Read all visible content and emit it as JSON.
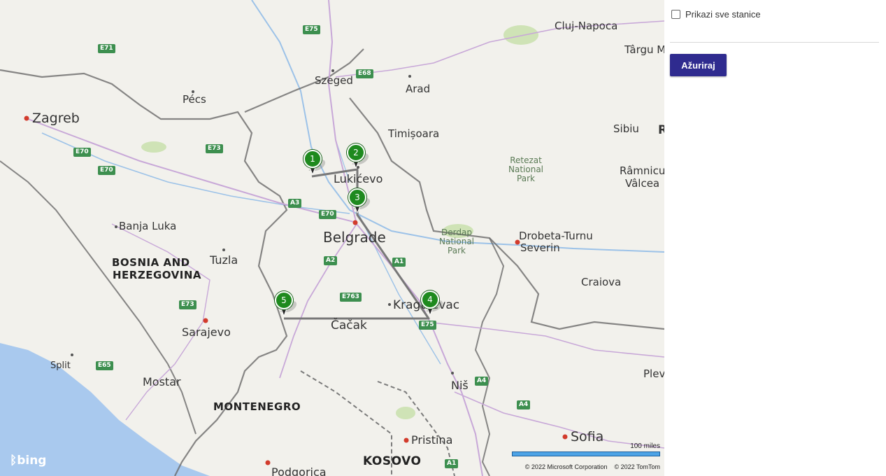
{
  "map": {
    "provider": "bing",
    "scale_label": "100 miles",
    "copyright": [
      "© 2022 Microsoft Corporation",
      "© 2022 TomTom"
    ],
    "colors": {
      "land": "#f2f1ec",
      "water": "#a9c9ee",
      "route": "#787878",
      "pin": "#1e8a1e",
      "border": "#6a6a6a"
    },
    "places": {
      "cluj": "Cluj-Napoca",
      "targu": "Târgu M",
      "szeged": "Szeged",
      "arad": "Arad",
      "pecs": "Pécs",
      "zagreb": "Zagreb",
      "timisoara": "Timișoara",
      "sibiu": "Sibiu",
      "rimnicu": "Râmnicu",
      "valcea": "Vâlcea",
      "lukicevo": "Lukićevo",
      "banja": "Banja Luka",
      "belgrade": "Belgrade",
      "drobeta": "Drobeta-Turnu",
      "severin": "Severin",
      "tuzla": "Tuzla",
      "craiova": "Craiova",
      "kragujevac": "Kragujevac",
      "sarajevo": "Sarajevo",
      "cacak": "Čačak",
      "split": "Split",
      "pleven": "Pleve",
      "nis": "Niš",
      "mostar": "Mostar",
      "sofia": "Sofia",
      "pristina": "Pristina",
      "podgorica": "Podgorica",
      "edge_r": "R"
    },
    "countries": {
      "bih1": "BOSNIA AND",
      "bih2": "HERZEGOVINA",
      "mne": "MONTENEGRO",
      "kos": "KOSOVO"
    },
    "parks": {
      "retezat": [
        "Retezat",
        "National",
        "Park"
      ],
      "derdap": [
        "Derdap",
        "National",
        "Park"
      ]
    },
    "roads": [
      "E75",
      "E71",
      "E68",
      "E70",
      "E73",
      "E70",
      "A3",
      "E70",
      "A2",
      "A1",
      "E763",
      "E73",
      "E75",
      "E65",
      "A4",
      "A4",
      "A1"
    ],
    "pins": [
      "1",
      "2",
      "3",
      "4",
      "5"
    ]
  },
  "panel": {
    "checkbox_label": "Prikazi sve stanice",
    "checkbox_checked": false,
    "update_button": "Ažuriraj"
  }
}
